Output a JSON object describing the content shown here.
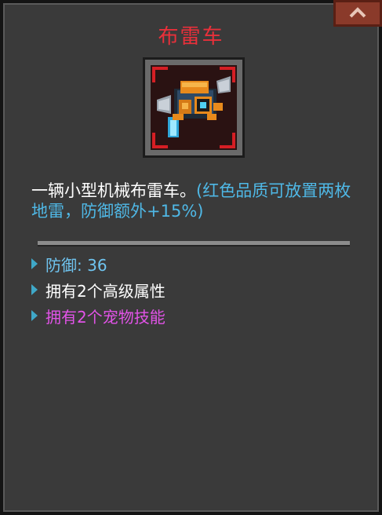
{
  "item": {
    "name": "布雷车",
    "icon": "mine-layer-vehicle-icon",
    "description_main": "一辆小型机械布雷车。",
    "description_highlight": "(红色品质可放置两枚地雷，防御额外+15%)"
  },
  "stats": [
    {
      "label": "防御: 36"
    },
    {
      "label": "拥有2个高级属性"
    },
    {
      "label": "拥有2个宠物技能"
    }
  ],
  "colors": {
    "title": "#e8303a",
    "highlight": "#4fb8e6",
    "defense": "#6fc4f0",
    "attributes": "#ffffff",
    "skills": "#e253e8",
    "rarity_frame": "#d51e24"
  },
  "controls": {
    "collapse_icon": "chevron-up-icon"
  }
}
